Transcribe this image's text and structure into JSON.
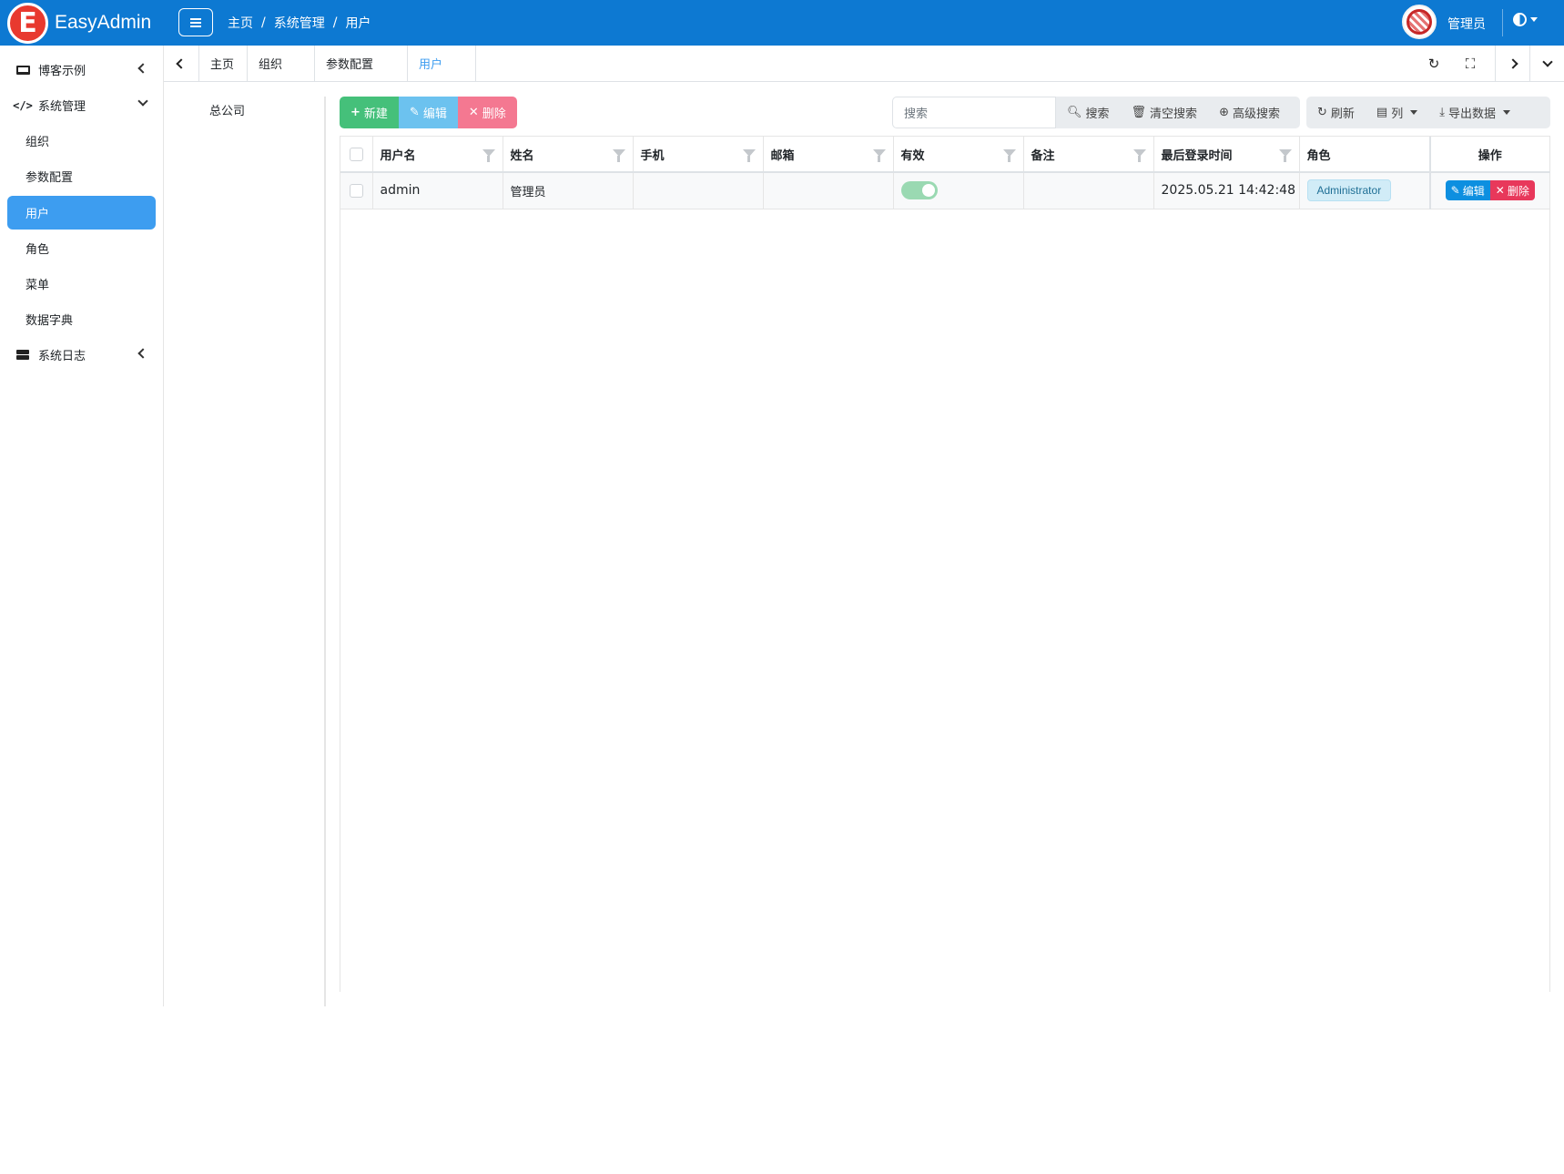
{
  "app": {
    "logo_letter": "E",
    "title": "EasyAdmin",
    "brand_color": "#0d79d2"
  },
  "breadcrumb": [
    "主页",
    "系统管理",
    "用户"
  ],
  "user": {
    "name": "管理员"
  },
  "sidebar": {
    "items": [
      {
        "label": "博客示例",
        "icon": "laptop-icon",
        "type": "group",
        "expanded": false
      },
      {
        "label": "系统管理",
        "icon": "code-icon",
        "type": "group",
        "expanded": true
      },
      {
        "label": "组织",
        "type": "sub"
      },
      {
        "label": "参数配置",
        "type": "sub"
      },
      {
        "label": "用户",
        "type": "sub",
        "active": true
      },
      {
        "label": "角色",
        "type": "sub"
      },
      {
        "label": "菜单",
        "type": "sub"
      },
      {
        "label": "数据字典",
        "type": "sub"
      },
      {
        "label": "系统日志",
        "icon": "server-icon",
        "type": "group",
        "expanded": false
      }
    ]
  },
  "tabs": [
    {
      "label": "主页"
    },
    {
      "label": "组织"
    },
    {
      "label": "参数配置"
    },
    {
      "label": "用户",
      "active": true
    }
  ],
  "org_tree": {
    "root": "总公司"
  },
  "toolbar": {
    "new_label": "新建",
    "edit_label": "编辑",
    "delete_label": "删除",
    "search_placeholder": "搜索",
    "search_label": "搜索",
    "clear_label": "清空搜索",
    "advanced_label": "高级搜索",
    "refresh_label": "刷新",
    "columns_label": "列",
    "export_label": "导出数据"
  },
  "table": {
    "columns": [
      "用户名",
      "姓名",
      "手机",
      "邮箱",
      "有效",
      "备注",
      "最后登录时间",
      "角色",
      "操作"
    ],
    "rows": [
      {
        "username": "admin",
        "name": "管理员",
        "phone": "",
        "email": "",
        "enabled": true,
        "note": "",
        "last_login": "2025.05.21 14:42:48",
        "role": "Administrator",
        "edit_label": "编辑",
        "delete_label": "删除"
      }
    ]
  }
}
